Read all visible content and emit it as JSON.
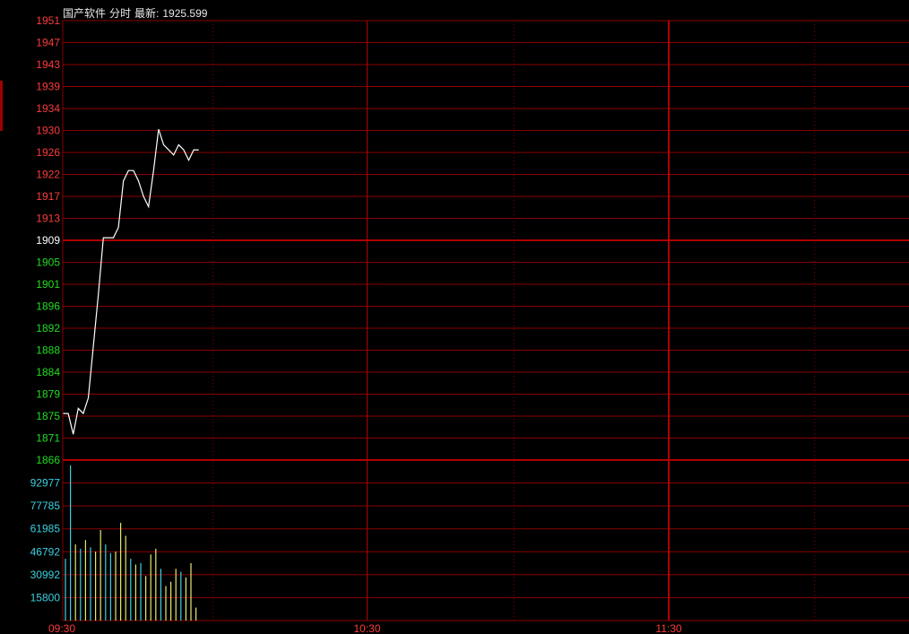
{
  "header": {
    "name": "国产软件",
    "mode": "分时",
    "latest_label": "最新:",
    "latest_value": "1925.599"
  },
  "colors": {
    "background": "#000000",
    "grid": "#8b0000",
    "grid_strong": "#b00000",
    "up": "#ff3b3b",
    "down": "#22dd22",
    "flat": "#ffffff",
    "price_line": "#ffffff",
    "volume_up": "#e8e86a",
    "volume_down": "#3cd0e0",
    "volume_axis": "#3cd0e0",
    "time_axis": "#ff3b3b"
  },
  "chart_data": {
    "type": "line",
    "price": {
      "prev_close": 1909,
      "ylim": [
        1866,
        1951
      ],
      "ticks": [
        1951,
        1947,
        1943,
        1939,
        1934,
        1930,
        1926,
        1922,
        1917,
        1913,
        1909,
        1905,
        1901,
        1896,
        1892,
        1888,
        1884,
        1879,
        1875,
        1871,
        1866
      ],
      "values": [
        1875,
        1875,
        1871,
        1876,
        1875,
        1878,
        1888,
        1898,
        1909,
        1909,
        1909,
        1911,
        1920,
        1922,
        1922,
        1920,
        1917,
        1915,
        1922,
        1930,
        1927,
        1926,
        1925,
        1927,
        1926,
        1924,
        1926,
        1926
      ]
    },
    "volume": {
      "ylim": [
        0,
        108000
      ],
      "ticks": [
        92977,
        77785,
        61985,
        46792,
        30992,
        15800
      ],
      "values": [
        43000,
        108000,
        53000,
        50000,
        56000,
        51000,
        48000,
        63000,
        53000,
        47000,
        48000,
        68000,
        59000,
        43000,
        39000,
        40000,
        31000,
        46000,
        50000,
        36000,
        24000,
        27000,
        36000,
        34000,
        30000,
        40000,
        9000
      ],
      "directions": [
        "down",
        "down",
        "up",
        "down",
        "up",
        "down",
        "up",
        "up",
        "down",
        "down",
        "up",
        "up",
        "up",
        "down",
        "up",
        "down",
        "up",
        "up",
        "up",
        "down",
        "up",
        "up",
        "up",
        "down",
        "up",
        "up",
        "up"
      ]
    },
    "x_ticks": [
      "09:30",
      "10:30",
      "11:30"
    ],
    "grid": true
  }
}
